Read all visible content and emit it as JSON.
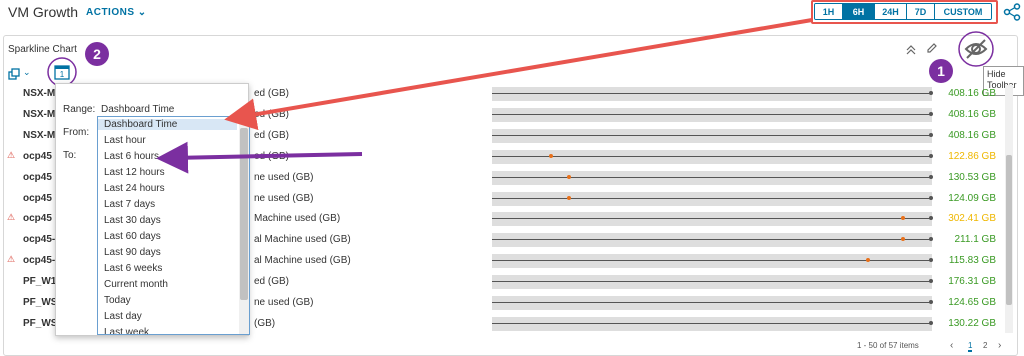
{
  "header": {
    "title": "VM Growth",
    "actions": "ACTIONS"
  },
  "time_range": {
    "options": [
      "1H",
      "6H",
      "24H",
      "7D",
      "CUSTOM"
    ],
    "selected": "6H"
  },
  "widget": {
    "title": "Sparkline Chart",
    "hide_tooltip": "Hide Toolbar"
  },
  "rows": [
    {
      "name": "NSX-M",
      "metric": "ed (GB)",
      "value": "408.16 GB",
      "status": "normal",
      "alert": false
    },
    {
      "name": "NSX-M",
      "metric": "ed (GB)",
      "value": "408.16 GB",
      "status": "normal",
      "alert": false
    },
    {
      "name": "NSX-M",
      "metric": "ed (GB)",
      "value": "408.16 GB",
      "status": "normal",
      "alert": false
    },
    {
      "name": "ocp45",
      "metric": "ed (GB)",
      "value": "122.86 GB",
      "status": "warn",
      "alert": true
    },
    {
      "name": "ocp45",
      "metric": "ne used (GB)",
      "value": "130.53 GB",
      "status": "normal",
      "alert": false
    },
    {
      "name": "ocp45",
      "metric": "ne used (GB)",
      "value": "124.09 GB",
      "status": "normal",
      "alert": false
    },
    {
      "name": "ocp45",
      "metric": "Machine used (GB)",
      "value": "302.41 GB",
      "status": "warn",
      "alert": true
    },
    {
      "name": "ocp45-pnpnt-w",
      "metric": "al Machine used (GB)",
      "value": "211.1 GB",
      "status": "normal",
      "alert": false
    },
    {
      "name": "ocp45-pnpnt-w",
      "metric": "al Machine used (GB)",
      "value": "115.83 GB",
      "status": "normal",
      "alert": true
    },
    {
      "name": "PF_W10_Client",
      "metric": "ed (GB)",
      "value": "176.31 GB",
      "status": "normal",
      "alert": false
    },
    {
      "name": "PF_WS1_AppV",
      "metric": "ne used (GB)",
      "value": "124.65 GB",
      "status": "normal",
      "alert": false
    },
    {
      "name": "PF_WS1_CN Di",
      "metric": "(GB)",
      "value": "130.22 GB",
      "status": "normal",
      "alert": false
    }
  ],
  "popup": {
    "range_label": "Range:",
    "range_value": "Dashboard Time",
    "from_label": "From:",
    "to_label": "To:"
  },
  "dropdown": {
    "options": [
      "Dashboard Time",
      "Last hour",
      "Last 6 hours",
      "Last 12 hours",
      "Last 24 hours",
      "Last 7 days",
      "Last 30 days",
      "Last 60 days",
      "Last 90 days",
      "Last 6 weeks",
      "Current month",
      "Today",
      "Last day",
      "Last week"
    ],
    "highlighted": "Dashboard Time"
  },
  "annotations": {
    "badge1": "1",
    "badge2": "2"
  },
  "pagination": {
    "summary": "1 - 50 of 57 items",
    "pages": [
      "1",
      "2"
    ],
    "current": "1"
  },
  "colors": {
    "accent": "#0072a3",
    "green": "#3a9a24",
    "warn": "#efb700",
    "arrow_red": "#e8554e",
    "arrow_purple": "#7b2fa0"
  }
}
